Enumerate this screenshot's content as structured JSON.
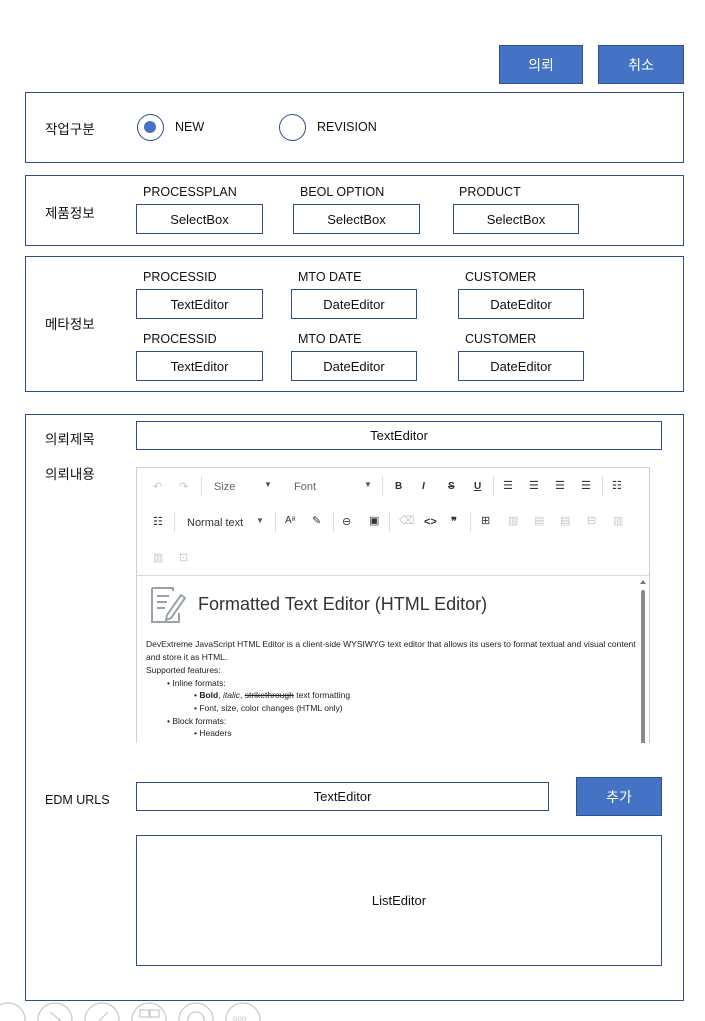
{
  "header": {
    "request_label": "의뢰",
    "cancel_label": "취소"
  },
  "work_type": {
    "label": "작업구분",
    "options": [
      {
        "label": "NEW",
        "selected": true
      },
      {
        "label": "REVISION",
        "selected": false
      }
    ]
  },
  "product_info": {
    "label": "제품정보",
    "fields": [
      {
        "label": "PROCESSPLAN",
        "value": "SelectBox"
      },
      {
        "label": "BEOL OPTION",
        "value": "SelectBox"
      },
      {
        "label": "PRODUCT",
        "value": "SelectBox"
      }
    ]
  },
  "meta_info": {
    "label": "메타정보",
    "row1": [
      {
        "label": "PROCESSID",
        "value": "TextEditor"
      },
      {
        "label": "MTO DATE",
        "value": "DateEditor"
      },
      {
        "label": "CUSTOMER",
        "value": "DateEditor"
      }
    ],
    "row2": [
      {
        "label": "PROCESSID",
        "value": "TextEditor"
      },
      {
        "label": "MTO DATE",
        "value": "DateEditor"
      },
      {
        "label": "CUSTOMER",
        "value": "DateEditor"
      }
    ]
  },
  "request": {
    "title_label": "의뢰제목",
    "title_value": "TextEditor",
    "content_label": "의뢰내용",
    "toolbar": {
      "size": "Size",
      "font": "Font",
      "header": "Normal text",
      "bold": "B",
      "italic": "I",
      "strike": "S",
      "underline": "U",
      "undo": "↶",
      "redo": "↷",
      "code": "<>",
      "quote": "❞"
    },
    "editor": {
      "heading": "Formatted Text Editor (HTML Editor)",
      "intro": "DevExtreme JavaScript HTML Editor is a client-side WYSIWYG text editor that allows its users to format textual and visual content and store it as HTML.",
      "supported": "Supported features:",
      "inline": "Inline formats:",
      "bold": "Bold",
      "italic": "italic",
      "strike": "strikethrough",
      "formatting": "text formatting",
      "font_line": "Font, size, color changes (HTML only)",
      "block": "Block formats:",
      "headers": "Headers"
    },
    "edm_label": "EDM URLS",
    "edm_value": "TextEditor",
    "add_label": "추가",
    "list_value": "ListEditor"
  },
  "colors": {
    "accent": "#4472c4",
    "border": "#2f4f86"
  }
}
